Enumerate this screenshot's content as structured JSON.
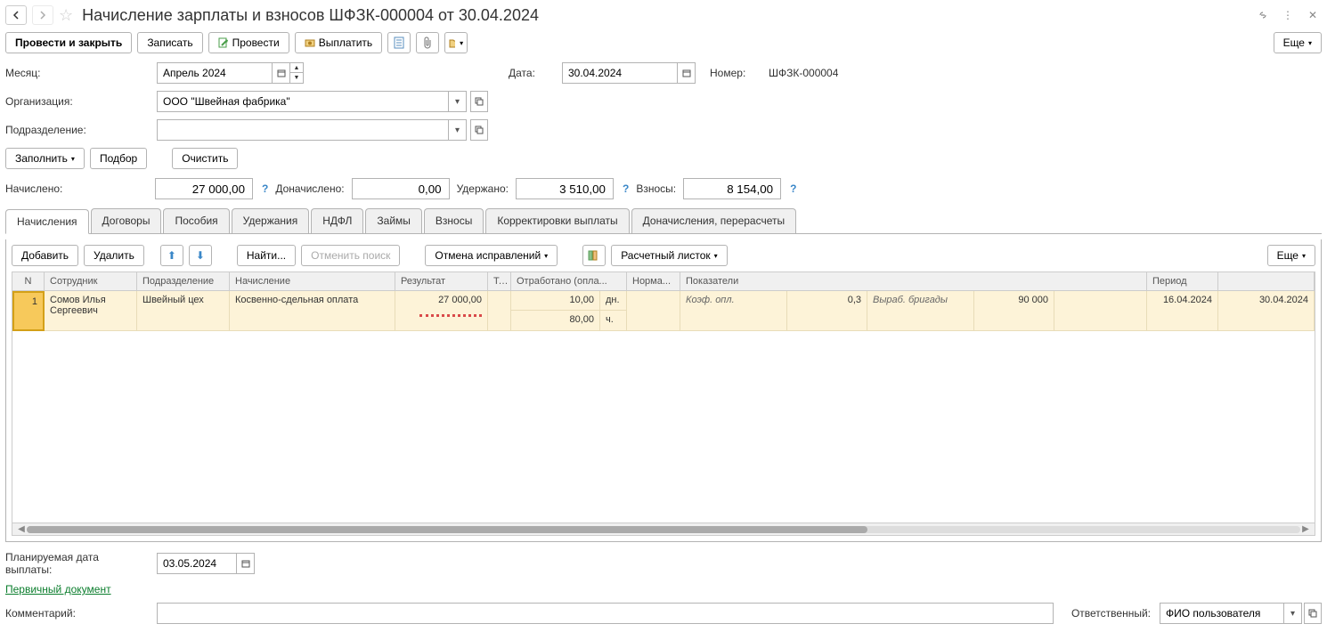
{
  "header": {
    "title": "Начисление зарплаты и взносов ШФЗК-000004 от 30.04.2024"
  },
  "toolbar": {
    "post_close": "Провести и закрыть",
    "record": "Записать",
    "post": "Провести",
    "pay": "Выплатить",
    "more": "Еще"
  },
  "fields": {
    "month_label": "Месяц:",
    "month_value": "Апрель 2024",
    "date_label": "Дата:",
    "date_value": "30.04.2024",
    "number_label": "Номер:",
    "number_value": "ШФЗК-000004",
    "org_label": "Организация:",
    "org_value": "ООО \"Швейная фабрика\"",
    "dept_label": "Подразделение:",
    "dept_value": ""
  },
  "actions": {
    "fill": "Заполнить",
    "pick": "Подбор",
    "clear": "Очистить"
  },
  "summary": {
    "accrued_label": "Начислено:",
    "accrued_value": "27 000,00",
    "add_accrued_label": "Доначислено:",
    "add_accrued_value": "0,00",
    "withheld_label": "Удержано:",
    "withheld_value": "3 510,00",
    "contrib_label": "Взносы:",
    "contrib_value": "8 154,00"
  },
  "tabs": [
    "Начисления",
    "Договоры",
    "Пособия",
    "Удержания",
    "НДФЛ",
    "Займы",
    "Взносы",
    "Корректировки выплаты",
    "Доначисления, перерасчеты"
  ],
  "table_toolbar": {
    "add": "Добавить",
    "delete": "Удалить",
    "find": "Найти...",
    "cancel_search": "Отменить поиск",
    "cancel_corr": "Отмена исправлений",
    "payslip": "Расчетный листок",
    "more": "Еще"
  },
  "table": {
    "headers": {
      "n": "N",
      "employee": "Сотрудник",
      "dept": "Подразделение",
      "accrual": "Начисление",
      "result": "Результат",
      "t": "Т...",
      "worked": "Отработано (опла...",
      "norm": "Норма...",
      "indicators": "Показатели",
      "period": "Период"
    },
    "row": {
      "n": "1",
      "employee": "Сомов Илья Сергеевич",
      "dept": "Швейный цех",
      "accrual": "Косвенно-сдельная оплата",
      "result": "27 000,00",
      "worked_days": "10,00",
      "worked_days_unit": "дн.",
      "worked_hours": "80,00",
      "worked_hours_unit": "ч.",
      "ind1_name": "Коэф. опл.",
      "ind1_val": "0,3",
      "ind2_name": "Выраб. бригады",
      "ind2_val": "90 000",
      "period_from": "16.04.2024",
      "period_to": "30.04.2024"
    }
  },
  "footer": {
    "plan_date_label": "Планируемая дата выплаты:",
    "plan_date_value": "03.05.2024",
    "source_doc": "Первичный документ",
    "comment_label": "Комментарий:",
    "comment_value": "",
    "responsible_label": "Ответственный:",
    "responsible_value": "ФИО пользователя"
  }
}
